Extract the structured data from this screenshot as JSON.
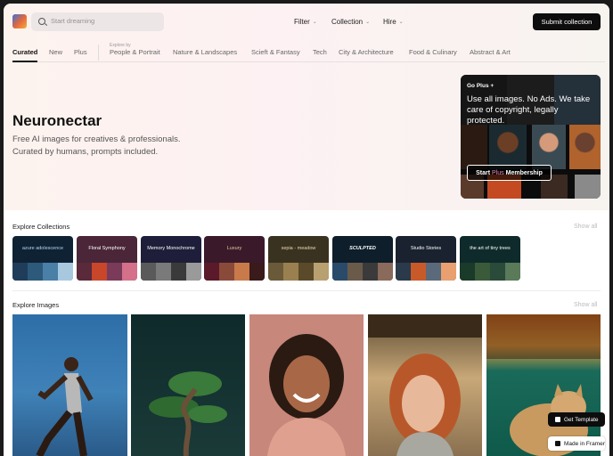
{
  "header": {
    "search_placeholder": "Start dreaming",
    "nav": [
      "Filter",
      "Collection",
      "Hire"
    ],
    "submit_label": "Submit collection"
  },
  "tabs": {
    "primary": [
      "Curated",
      "New",
      "Plus"
    ],
    "explore_by_label": "Explore by",
    "categories": [
      "People & Portrait",
      "Nature & Landscapes",
      "Scieft & Fantasy",
      "Tech",
      "City & Architecture",
      "Food & Culinary",
      "Abstract & Art"
    ]
  },
  "hero": {
    "title": "Neuronectar",
    "subtitle_line1": "Free AI images for creatives & professionals.",
    "subtitle_line2": "Curated by humans, prompts included."
  },
  "plus_card": {
    "tag": "Go Plus +",
    "headline": "Use all images. No Ads. We take care of copyright, legally protected.",
    "cta_prefix": "Start",
    "cta_accent": "Plus",
    "cta_suffix": "Membership"
  },
  "collections": {
    "title": "Explore Collections",
    "show_all": "Show all",
    "items": [
      {
        "title": "azure adolescence"
      },
      {
        "title": "Floral Symphony"
      },
      {
        "title": "Memory Monochrome"
      },
      {
        "title": "Luxury"
      },
      {
        "title": "sepia - meadow"
      },
      {
        "title": "SCULPTED"
      },
      {
        "title": "Studio Stories"
      },
      {
        "title": "the art of tiny trees"
      }
    ]
  },
  "images": {
    "title": "Explore Images",
    "show_all": "Show all"
  },
  "framer": {
    "get_template": "Get Template",
    "made_in": "Made in Framer"
  },
  "colors": {
    "accent_pink": "#f08ab8",
    "button_dark": "#0d0d0d"
  }
}
